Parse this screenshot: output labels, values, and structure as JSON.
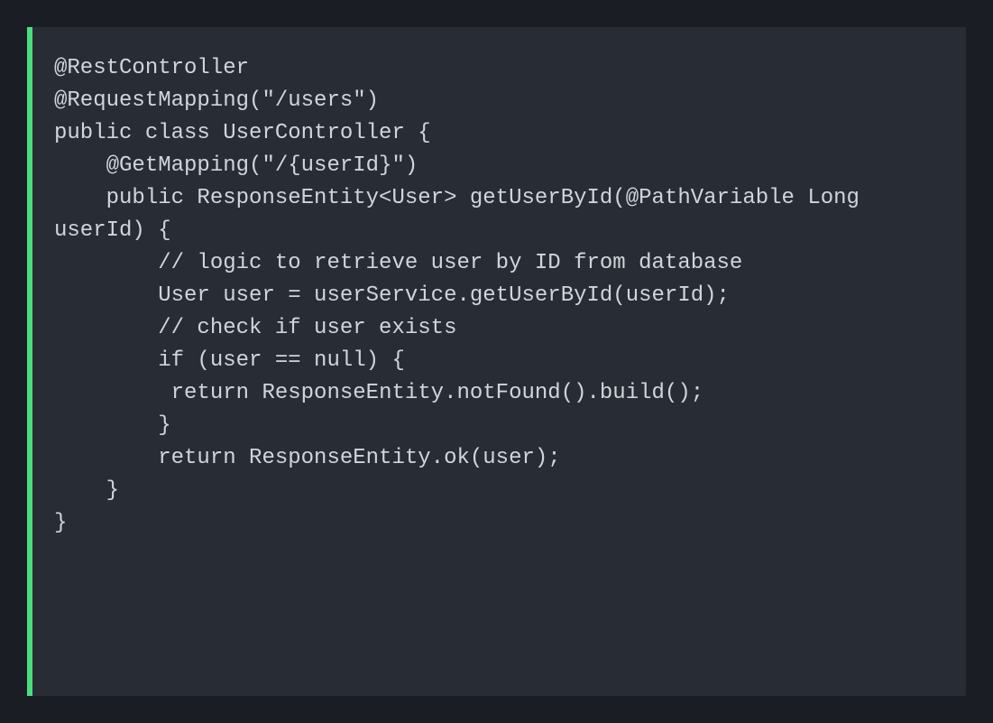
{
  "code": {
    "lines": [
      "@RestController",
      "@RequestMapping(\"/users\")",
      "public class UserController {",
      "",
      "    @GetMapping(\"/{userId}\")",
      "    public ResponseEntity<User> getUserById(@PathVariable Long userId) {",
      "        // logic to retrieve user by ID from database",
      "        User user = userService.getUserById(userId);",
      "",
      "        // check if user exists",
      "        if (user == null) {",
      "         return ResponseEntity.notFound().build();",
      "        }",
      "",
      "        return ResponseEntity.ok(user);",
      "    }",
      "",
      "}"
    ]
  },
  "colors": {
    "background": "#1a1d24",
    "codeBackground": "#282c34",
    "accent": "#4ade80",
    "text": "#d1d5db"
  }
}
